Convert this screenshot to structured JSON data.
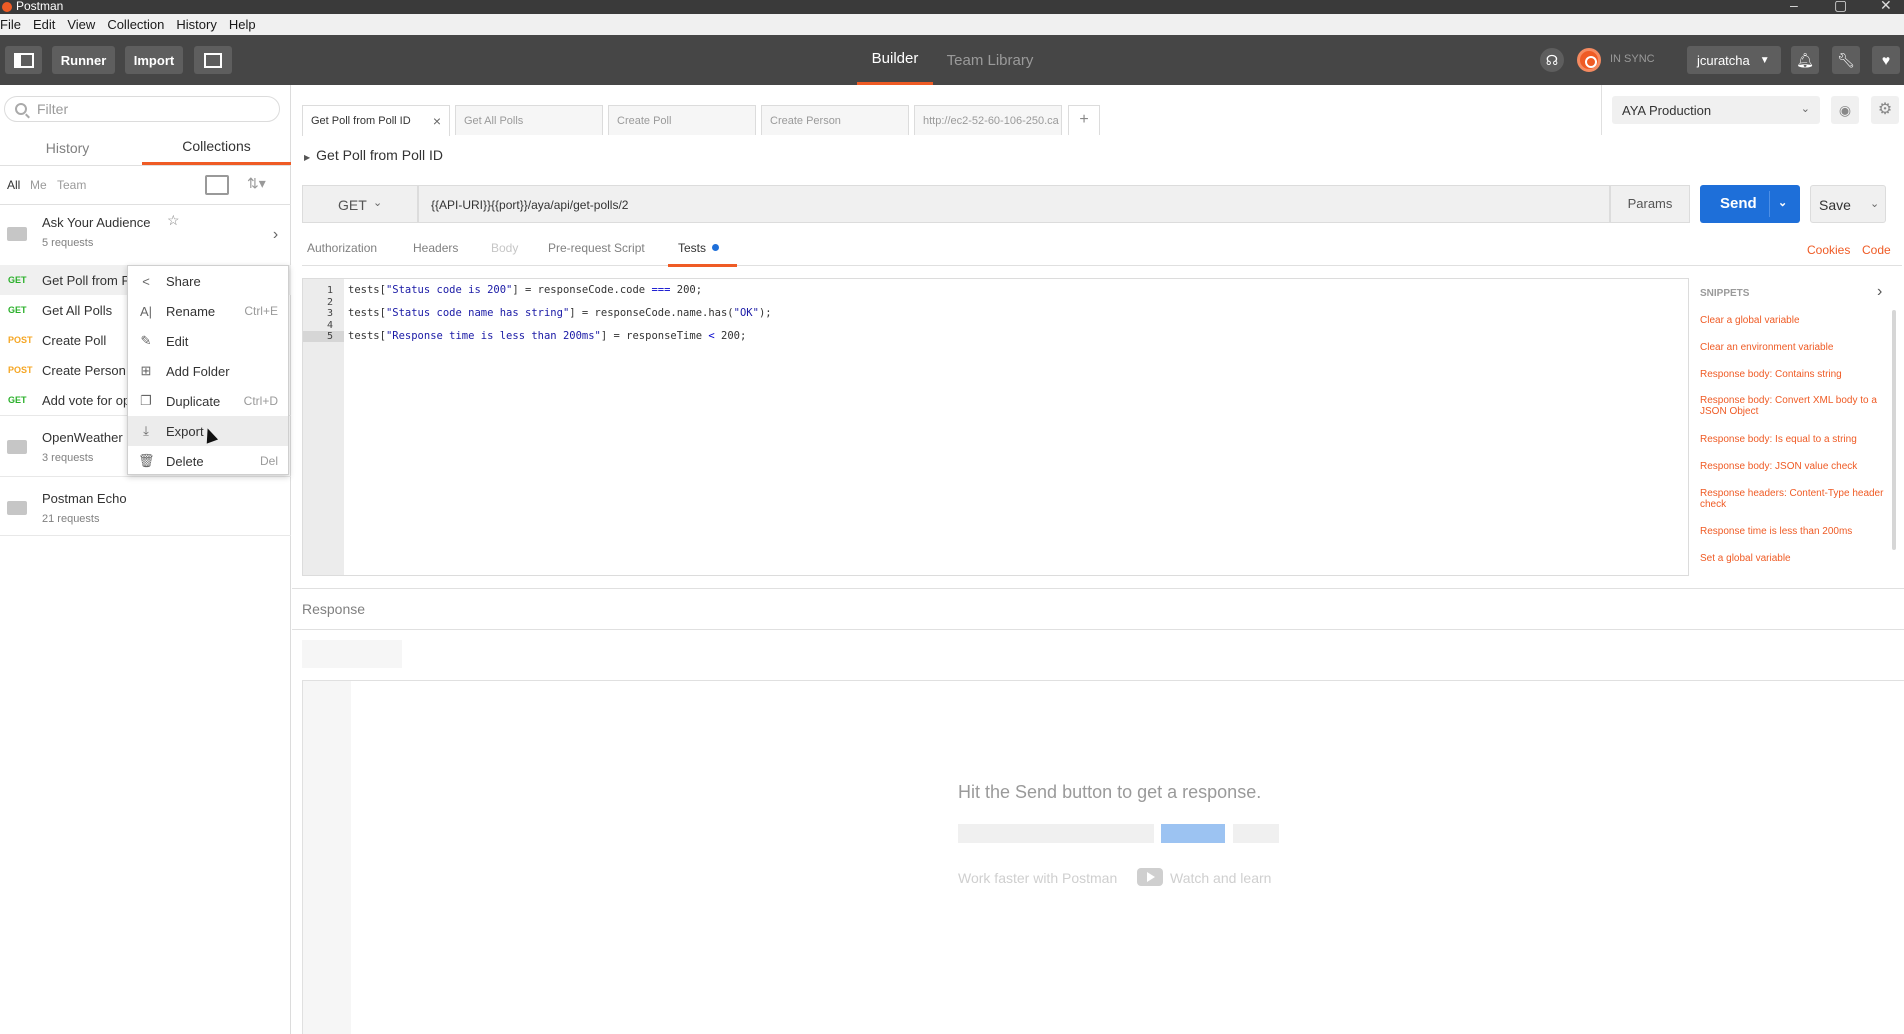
{
  "window": {
    "title": "Postman"
  },
  "menubar": [
    "File",
    "Edit",
    "View",
    "Collection",
    "History",
    "Help"
  ],
  "header": {
    "runner": "Runner",
    "import": "Import",
    "tabs": {
      "builder": "Builder",
      "library": "Team Library"
    },
    "sync": "IN SYNC",
    "user": "jcuratcha",
    "accent": "#ef5b25"
  },
  "sidebar": {
    "filter_placeholder": "Filter",
    "tabs": {
      "history": "History",
      "collections": "Collections"
    },
    "filters": [
      "All",
      "Me",
      "Team"
    ],
    "collections": [
      {
        "name": "Ask Your Audience",
        "count": "5 requests"
      },
      {
        "name": "OpenWeather",
        "count": "3 requests"
      },
      {
        "name": "Postman Echo",
        "count": "21 requests"
      }
    ],
    "requests": [
      {
        "method": "GET",
        "name": "Get Poll from Poll ID"
      },
      {
        "method": "GET",
        "name": "Get All Polls"
      },
      {
        "method": "POST",
        "name": "Create Poll"
      },
      {
        "method": "POST",
        "name": "Create Person"
      },
      {
        "method": "GET",
        "name": "Add vote for option"
      }
    ]
  },
  "context_menu": [
    {
      "label": "Share",
      "shortcut": "",
      "icon": "share-icon"
    },
    {
      "label": "Rename",
      "shortcut": "Ctrl+E",
      "icon": "rename-icon"
    },
    {
      "label": "Edit",
      "shortcut": "",
      "icon": "pencil-icon"
    },
    {
      "label": "Add Folder",
      "shortcut": "",
      "icon": "add-folder-icon"
    },
    {
      "label": "Duplicate",
      "shortcut": "Ctrl+D",
      "icon": "duplicate-icon"
    },
    {
      "label": "Export",
      "shortcut": "",
      "icon": "download-icon"
    },
    {
      "label": "Delete",
      "shortcut": "Del",
      "icon": "trash-icon"
    }
  ],
  "request_tabs": [
    "Get Poll from Poll ID",
    "Get All Polls",
    "Create Poll",
    "Create Person",
    "http://ec2-52-60-106-250.ca"
  ],
  "environment": "AYA Production",
  "request": {
    "name": "Get Poll from Poll ID",
    "method": "GET",
    "url": "{{API-URI}}{{port}}/aya/api/get-polls/2",
    "params": "Params",
    "send": "Send",
    "save": "Save"
  },
  "subtabs": [
    "Authorization",
    "Headers",
    "Body",
    "Pre-request Script",
    "Tests"
  ],
  "links": {
    "cookies": "Cookies",
    "code": "Code"
  },
  "editor": {
    "lines": [
      "1",
      "2",
      "3",
      "4",
      "5"
    ],
    "code": {
      "l1a": "tests[",
      "l1s": "\"Status code is 200\"",
      "l1b": "] = responseCode.code ",
      "l1k": "===",
      "l1c": " 200;",
      "l3a": "tests[",
      "l3s": "\"Status code name has string\"",
      "l3b": "] = responseCode.name.has(",
      "l3s2": "\"OK\"",
      "l3c": ");",
      "l5a": "tests[",
      "l5s": "\"Response time is less than 200ms\"",
      "l5b": "] = responseTime ",
      "l5k": "<",
      "l5c": " 200;"
    }
  },
  "snippets": {
    "title": "SNIPPETS",
    "items": [
      "Clear a global variable",
      "Clear an environment variable",
      "Response body: Contains string",
      "Response body: Convert XML body to a JSON Object",
      "Response body: Is equal to a string",
      "Response body: JSON value check",
      "Response headers: Content-Type header check",
      "Response time is less than 200ms",
      "Set a global variable"
    ]
  },
  "response": {
    "title": "Response",
    "hint": "Hit the Send button to get a response.",
    "work": "Work faster with Postman",
    "watch": "Watch and learn"
  }
}
